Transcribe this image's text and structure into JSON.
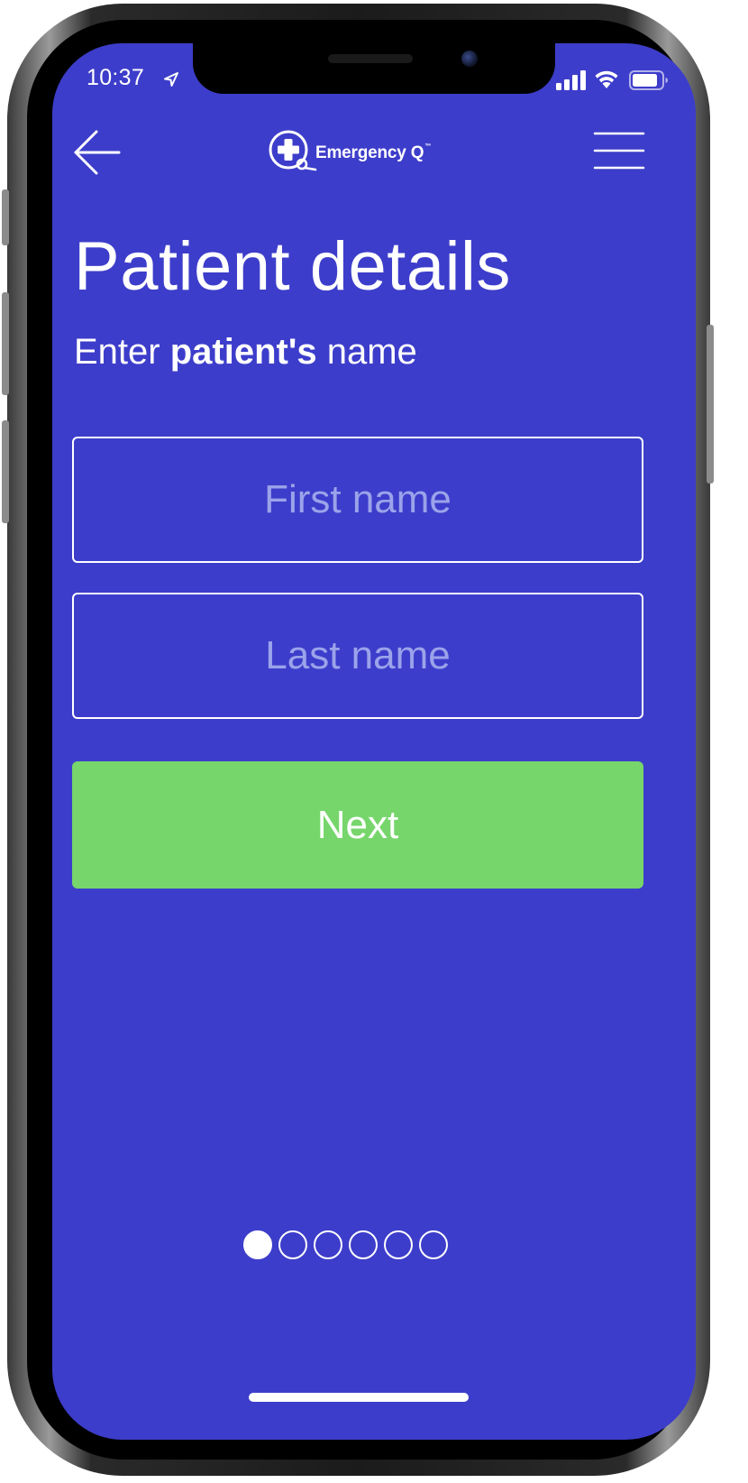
{
  "status_bar": {
    "time": "10:37",
    "icons": [
      "location-arrow-icon",
      "cellular-signal-icon",
      "wifi-icon",
      "battery-icon"
    ]
  },
  "header": {
    "back_icon": "arrow-left-icon",
    "logo_text": "Emergency Q",
    "logo_trademark": "™",
    "menu_icon": "hamburger-menu-icon"
  },
  "page": {
    "title": "Patient details",
    "subtitle_prefix": "Enter",
    "subtitle_bold": "patient's",
    "subtitle_suffix": "name"
  },
  "form": {
    "first_name": {
      "value": "",
      "placeholder": "First name"
    },
    "last_name": {
      "value": "",
      "placeholder": "Last name"
    },
    "next_label": "Next"
  },
  "pager": {
    "total_steps": 6,
    "current_step": 1
  },
  "colors": {
    "background": "#3d3dcb",
    "accent_button": "#76d66b",
    "text": "#ffffff",
    "placeholder": "#9ba3ea"
  }
}
